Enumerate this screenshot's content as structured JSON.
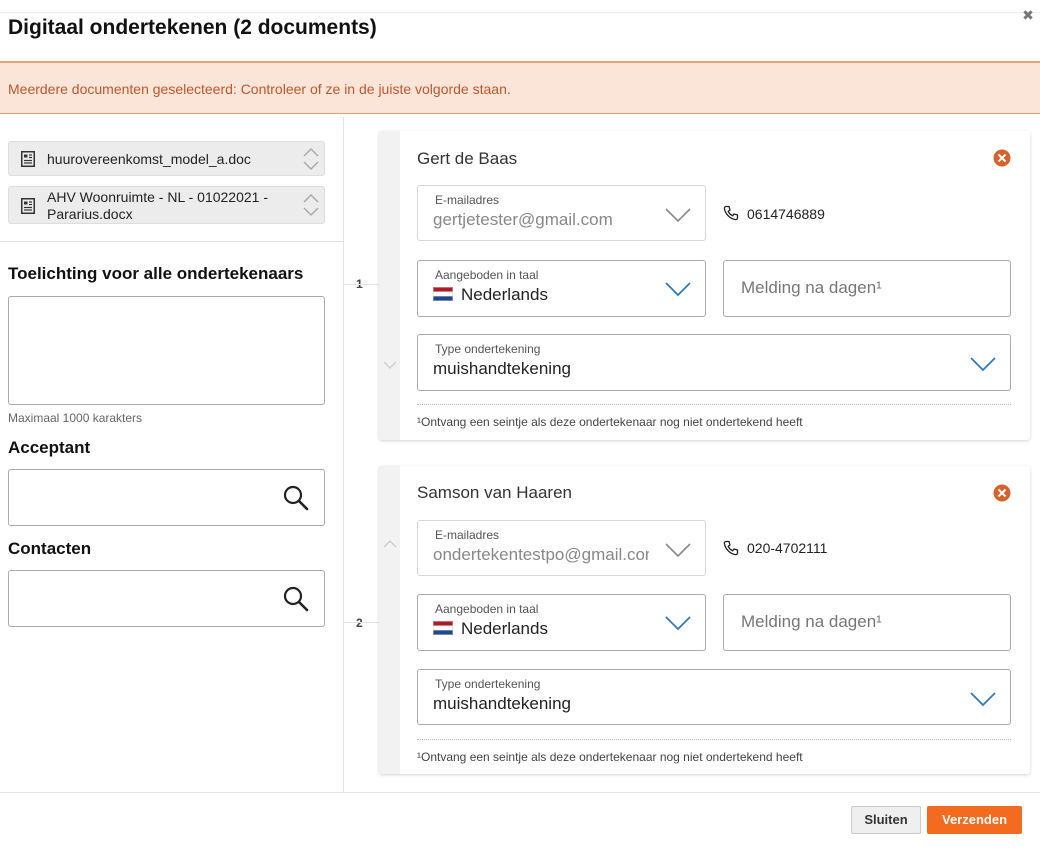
{
  "dialog": {
    "title": "Digitaal ondertekenen (2 documents)",
    "alert": "Meerdere documenten geselecteerd: Controleer of ze in de juiste volgorde staan."
  },
  "documents": [
    {
      "name": "huurovereenkomst_model_a.doc",
      "icon": "document-icon"
    },
    {
      "name": "AHV Woonruimte - NL - 01022021 - Pararius.docx",
      "icon": "document-icon"
    }
  ],
  "note": {
    "label": "Toelichting voor alle ondertekenaars",
    "value": "",
    "hint": "Maximaal 1000 karakters"
  },
  "acceptant": {
    "label": "Acceptant",
    "value": ""
  },
  "contacts": {
    "label": "Contacten",
    "value": ""
  },
  "signers": [
    {
      "order": "1",
      "name": "Gert de Baas",
      "email_label": "E-mailadres",
      "email": "gertjetester@gmail.com",
      "phone": "0614746889",
      "language_label": "Aangeboden in taal",
      "language": "Nederlands",
      "reminder_placeholder": "Melding na dagen¹",
      "type_label": "Type ondertekening",
      "type": "muishandtekening",
      "footnote": "¹Ontvang een seintje als deze ondertekenaar nog niet ondertekend heeft"
    },
    {
      "order": "2",
      "name": "Samson van Haaren",
      "email_label": "E-mailadres",
      "email": "ondertekentestpo@gmail.com",
      "phone": "020-4702111",
      "language_label": "Aangeboden in taal",
      "language": "Nederlands",
      "reminder_placeholder": "Melding na dagen¹",
      "type_label": "Type ondertekening",
      "type": "muishandtekening",
      "footnote": "¹Ontvang een seintje als deze ondertekenaar nog niet ondertekend heeft"
    }
  ],
  "buttons": {
    "close": "Sluiten",
    "send": "Verzenden"
  },
  "colors": {
    "accent": "#f26b1f",
    "alert_bg": "#fbe4d8",
    "alert_text": "#c0582a",
    "remove": "#d9622b",
    "dropdown": "#2f7bbf"
  }
}
